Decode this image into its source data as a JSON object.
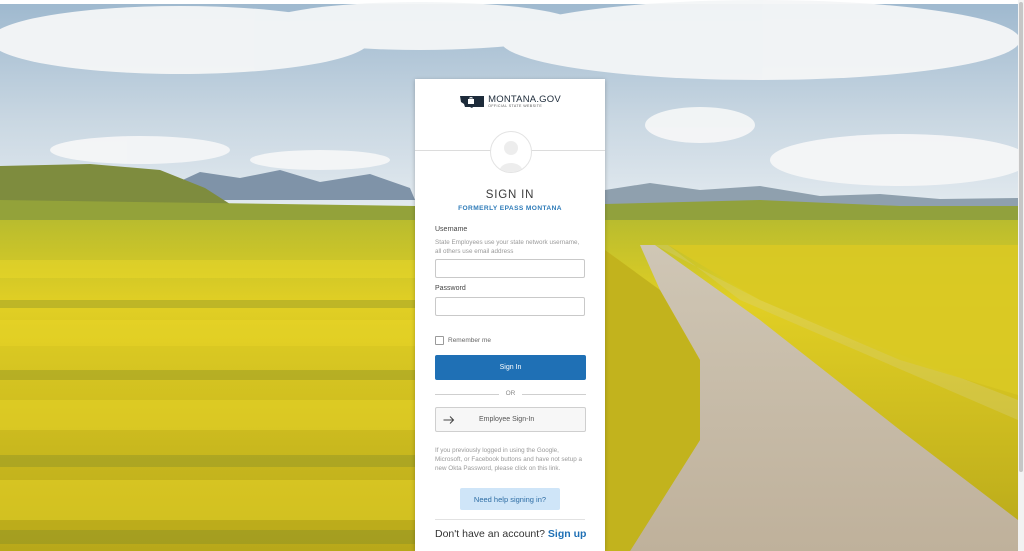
{
  "colors": {
    "primary": "#1f70b5",
    "help_bg": "#cfe5f8",
    "subtitle": "#2e7bb8"
  },
  "logo": {
    "title": "MONTANA.GOV",
    "subtitle": "OFFICIAL STATE WEBSITE",
    "icon": "montana-state-outline-icon"
  },
  "avatar": {
    "icon": "user-silhouette-icon"
  },
  "form": {
    "title": "SIGN IN",
    "subtitle": "FORMERLY EPASS MONTANA",
    "username_label": "Username",
    "username_hint": "State Employees use your state network username, all others use email address",
    "username_value": "",
    "password_label": "Password",
    "password_value": "",
    "remember_label": "Remember me",
    "remember_checked": false,
    "signin_label": "Sign In",
    "or_text": "OR",
    "employee_signin_label": "Employee Sign-In",
    "employee_icon": "arrow-right-icon",
    "info_text": "If you previously logged in using the Google, Microsoft, or Facebook buttons and have not setup a new Okta Password, please click on this link.",
    "help_label": "Need help signing in?"
  },
  "footer": {
    "question": "Don't have an account?",
    "signup_label": "Sign up"
  }
}
